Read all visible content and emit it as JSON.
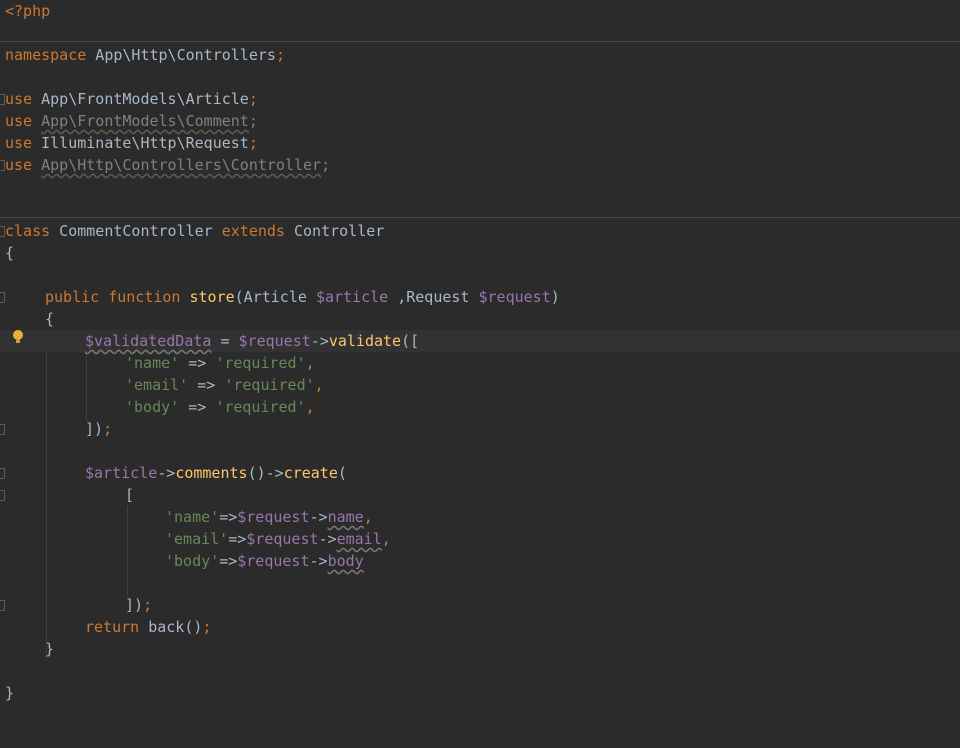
{
  "editor": {
    "language": "php",
    "colors": {
      "background": "#2b2b2b",
      "keyword": "#cc7832",
      "function": "#ffc66d",
      "variable": "#9876aa",
      "string": "#6a8759",
      "text": "#a9b7c6",
      "unused": "#808080"
    },
    "lines": {
      "php_open": "<?php",
      "namespace_kw": "namespace",
      "namespace_name": " App\\Http\\Controllers",
      "semi": ";",
      "use_kw": "use",
      "use1": " App\\FrontModels\\Article",
      "use2": "App\\FrontModels\\Comment",
      "use3": " Illuminate\\Http\\Request",
      "use4": "App\\Http\\Controllers\\Controller",
      "class_kw": "class",
      "class_name": " CommentController ",
      "extends_kw": "extends",
      "parent_name": " Controller",
      "open_brace": "{",
      "close_brace": "}",
      "public_kw": "public",
      "function_kw": "function",
      "method_name": "store",
      "params_open": "(Article ",
      "param_article": "$article",
      "params_mid": " ,Request ",
      "param_request": "$request",
      "params_close": ")",
      "validated_var": "$validatedData",
      "assign": " = ",
      "request_var": "$request",
      "arrow": "->",
      "validate_fn": "validate",
      "validate_open": "([",
      "name_key": "'name'",
      "fat_arrow": " => ",
      "required_val": "'required'",
      "comma": ",",
      "email_key": "'email'",
      "body_key": "'body'",
      "array_close": "])",
      "article_var": "$article",
      "comments_fn": "comments",
      "parens": "()",
      "create_fn": "create",
      "paren_open": "(",
      "bracket_open": "[",
      "fat_arrow_tight": "=>",
      "prop_name": "name",
      "prop_email": "email",
      "prop_body": "body",
      "return_kw": "return",
      "back_call": " back()"
    }
  }
}
